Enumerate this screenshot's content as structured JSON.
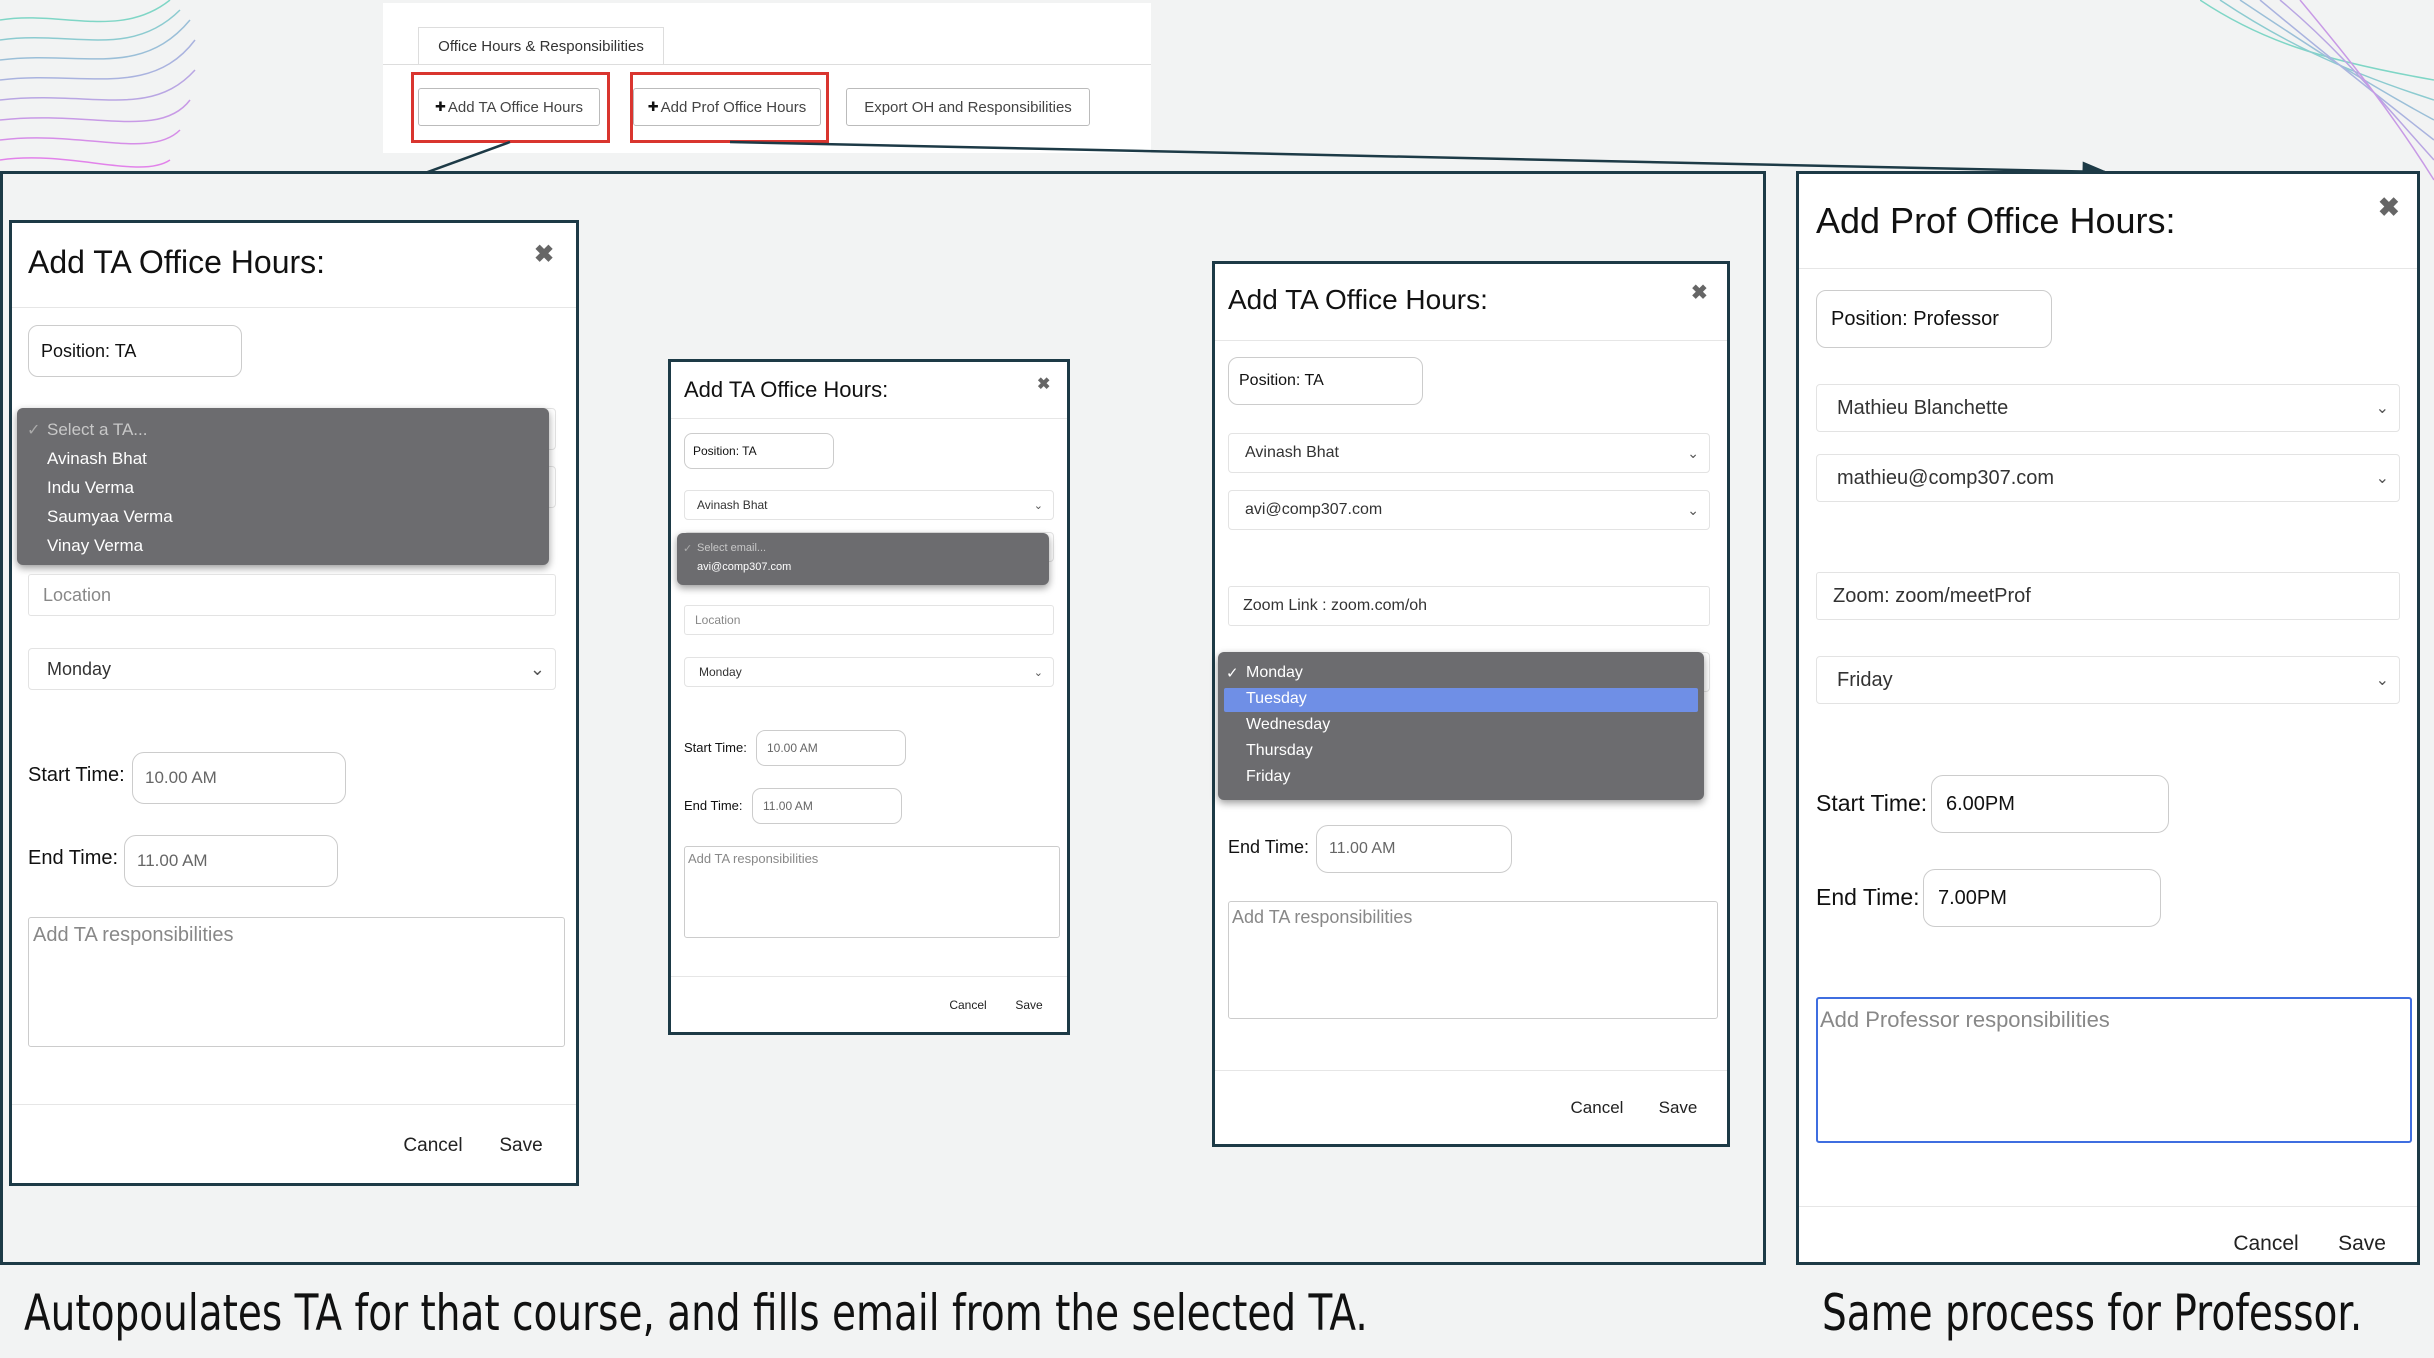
{
  "toolbar": {
    "tab_label": "Office Hours & Responsibilities",
    "add_ta_label": "Add TA Office Hours",
    "add_prof_label": "Add Prof Office Hours",
    "export_label": "Export OH and Responsibilities",
    "plus": "✚"
  },
  "modal1": {
    "title": "Add TA Office Hours:",
    "close": "✖",
    "position": "Position: TA",
    "ta_options": [
      "Select a TA...",
      "Avinash Bhat",
      "Indu Verma",
      "Saumyaa Verma",
      "Vinay Verma"
    ],
    "check": "✓",
    "location_placeholder": "Location",
    "day": "Monday",
    "start_label": "Start Time:",
    "start_value": "10.00 AM",
    "end_label": "End Time:",
    "end_value": "11.00 AM",
    "resp_placeholder": "Add TA responsibilities",
    "cancel": "Cancel",
    "save": "Save"
  },
  "modal2": {
    "title": "Add TA Office Hours:",
    "close": "✖",
    "position": "Position: TA",
    "ta": "Avinash Bhat",
    "email_options": [
      "Select email...",
      "avi@comp307.com"
    ],
    "check": "✓",
    "location_placeholder": "Location",
    "day": "Monday",
    "start_label": "Start Time:",
    "start_value": "10.00 AM",
    "end_label": "End Time:",
    "end_value": "11.00 AM",
    "resp_placeholder": "Add TA responsibilities",
    "cancel": "Cancel",
    "save": "Save"
  },
  "modal3": {
    "title": "Add TA Office Hours:",
    "close": "✖",
    "position": "Position: TA",
    "ta": "Avinash Bhat",
    "email": "avi@comp307.com",
    "zoom": "Zoom Link : zoom.com/oh",
    "day_options": [
      "Monday",
      "Tuesday",
      "Wednesday",
      "Thursday",
      "Friday"
    ],
    "check": "✓",
    "end_label": "End Time:",
    "end_value": "11.00 AM",
    "resp_placeholder": "Add TA responsibilities",
    "cancel": "Cancel",
    "save": "Save"
  },
  "modal4": {
    "title": "Add Prof Office Hours:",
    "close": "✖",
    "position": "Position: Professor",
    "prof": "Mathieu Blanchette",
    "email": "mathieu@comp307.com",
    "zoom": "Zoom: zoom/meetProf",
    "day": "Friday",
    "start_label": "Start Time:",
    "start_value": "6.00PM",
    "end_label": "End Time:",
    "end_value": "7.00PM",
    "resp_placeholder": "Add Professor responsibilities",
    "cancel": "Cancel",
    "save": "Save"
  },
  "captions": {
    "left": "Autopoulates TA for that course, and fills email from the selected TA.",
    "right": "Same process for Professor."
  },
  "colors": {
    "frame": "#1d3a46",
    "highlight": "#d9352f",
    "dropdown": "#6c6c6f",
    "selected": "#6f8fe6"
  }
}
